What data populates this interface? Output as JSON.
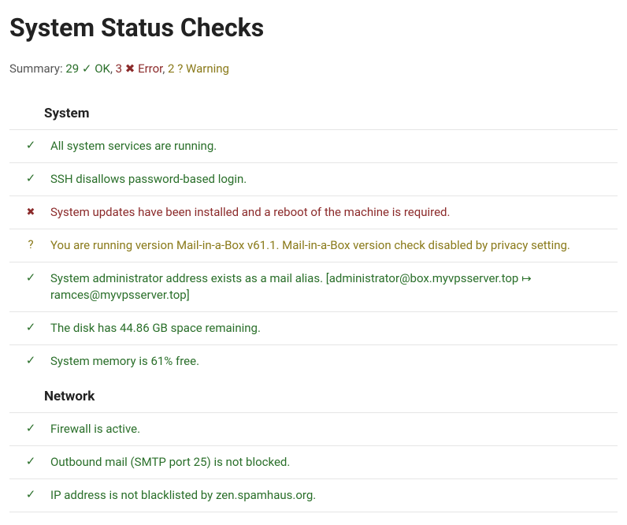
{
  "title": "System Status Checks",
  "summary": {
    "prefix": "Summary: ",
    "ok_count": "29",
    "ok_label": " ✓ OK",
    "sep1": ", ",
    "error_count": "3",
    "error_label": " ✖ Error",
    "sep2": ", ",
    "warning_count": "2",
    "warning_label": " ? Warning"
  },
  "sections": [
    {
      "heading": "System",
      "checks": [
        {
          "status": "ok",
          "message": "All system services are running."
        },
        {
          "status": "ok",
          "message": "SSH disallows password-based login."
        },
        {
          "status": "error",
          "message": "System updates have been installed and a reboot of the machine is required."
        },
        {
          "status": "warning",
          "message": "You are running version Mail-in-a-Box v61.1. Mail-in-a-Box version check disabled by privacy setting."
        },
        {
          "status": "ok",
          "message": "System administrator address exists as a mail alias. [administrator@box.myvpsserver.top ↦ ramces@myvpsserver.top]"
        },
        {
          "status": "ok",
          "message": "The disk has 44.86 GB space remaining."
        },
        {
          "status": "ok",
          "message": "System memory is 61% free."
        }
      ]
    },
    {
      "heading": "Network",
      "checks": [
        {
          "status": "ok",
          "message": "Firewall is active."
        },
        {
          "status": "ok",
          "message": "Outbound mail (SMTP port 25) is not blocked."
        },
        {
          "status": "ok",
          "message": "IP address is not blacklisted by zen.spamhaus.org."
        }
      ]
    }
  ]
}
